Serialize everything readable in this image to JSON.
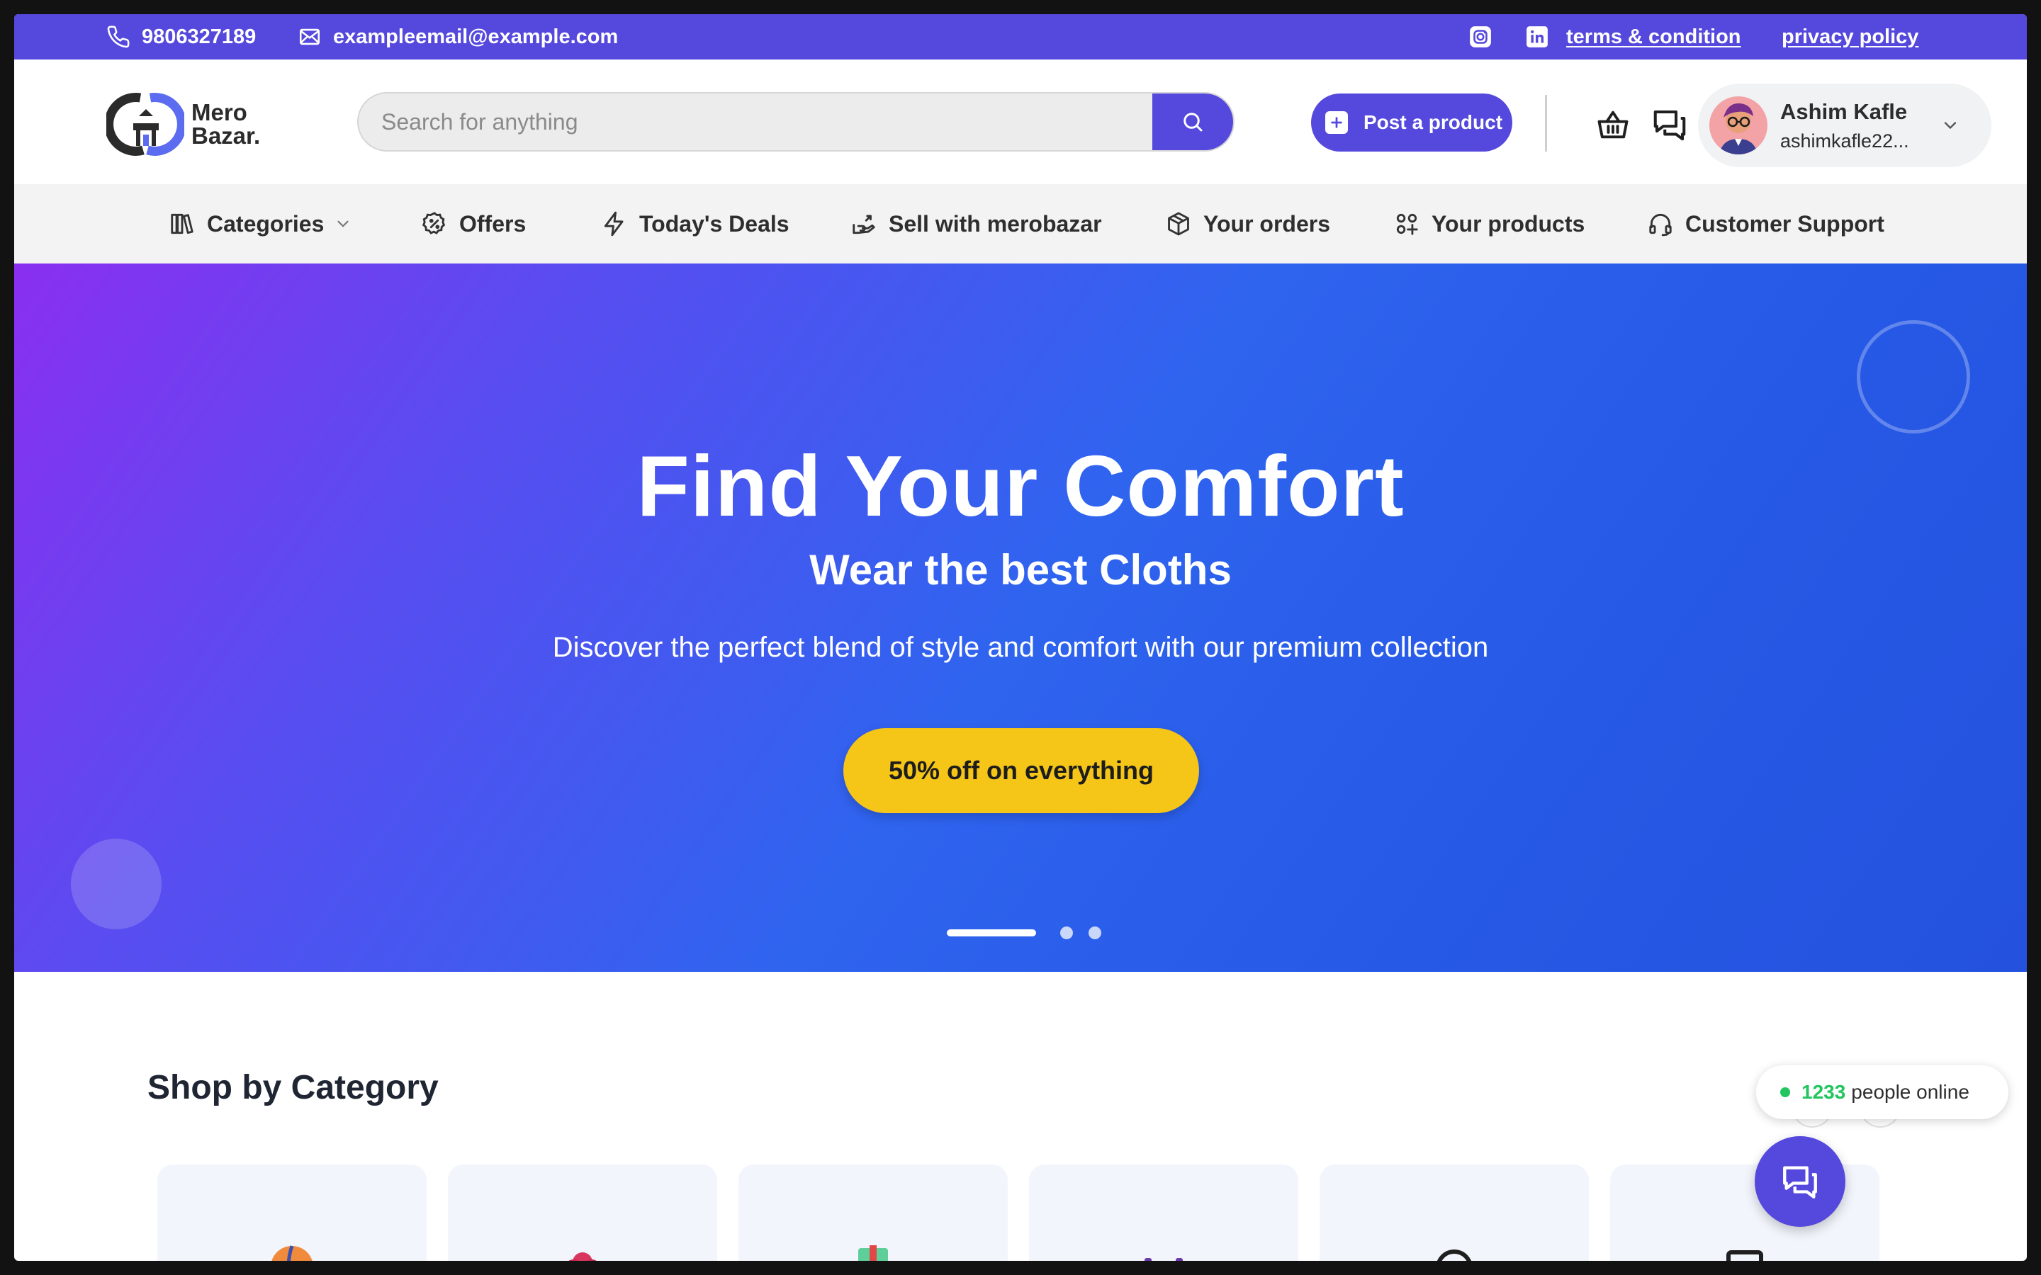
{
  "topbar": {
    "phone": "9806327189",
    "email": "exampleemail@example.com",
    "terms_label": "terms & condition",
    "privacy_label": "privacy policy"
  },
  "header": {
    "logo_line1": "Mero",
    "logo_line2": "Bazar.",
    "search_placeholder": "Search for anything",
    "post_button_label": "Post a product",
    "user": {
      "name": "Ashim Kafle",
      "email": "ashimkafle22..."
    }
  },
  "nav": {
    "items": [
      {
        "label": "Categories",
        "icon": "library-icon"
      },
      {
        "label": "Offers",
        "icon": "discount-badge-icon"
      },
      {
        "label": "Today's Deals",
        "icon": "lightning-icon"
      },
      {
        "label": "Sell with merobazar",
        "icon": "hand-coin-icon"
      },
      {
        "label": "Your orders",
        "icon": "package-icon"
      },
      {
        "label": "Your products",
        "icon": "grid-plus-icon"
      },
      {
        "label": "Customer Support",
        "icon": "headset-icon"
      }
    ]
  },
  "hero": {
    "title": "Find Your Comfort",
    "subtitle": "Wear the best Cloths",
    "description": "Discover the perfect blend of style and comfort with our premium collection",
    "cta_label": "50% off on everything",
    "slide_count": 3,
    "active_slide": 1
  },
  "categories": {
    "title": "Shop by Category"
  },
  "online": {
    "count": "1233",
    "label": "people online"
  },
  "colors": {
    "brand": "#5548dc",
    "cta": "#f5c518",
    "online": "#22c55e"
  }
}
